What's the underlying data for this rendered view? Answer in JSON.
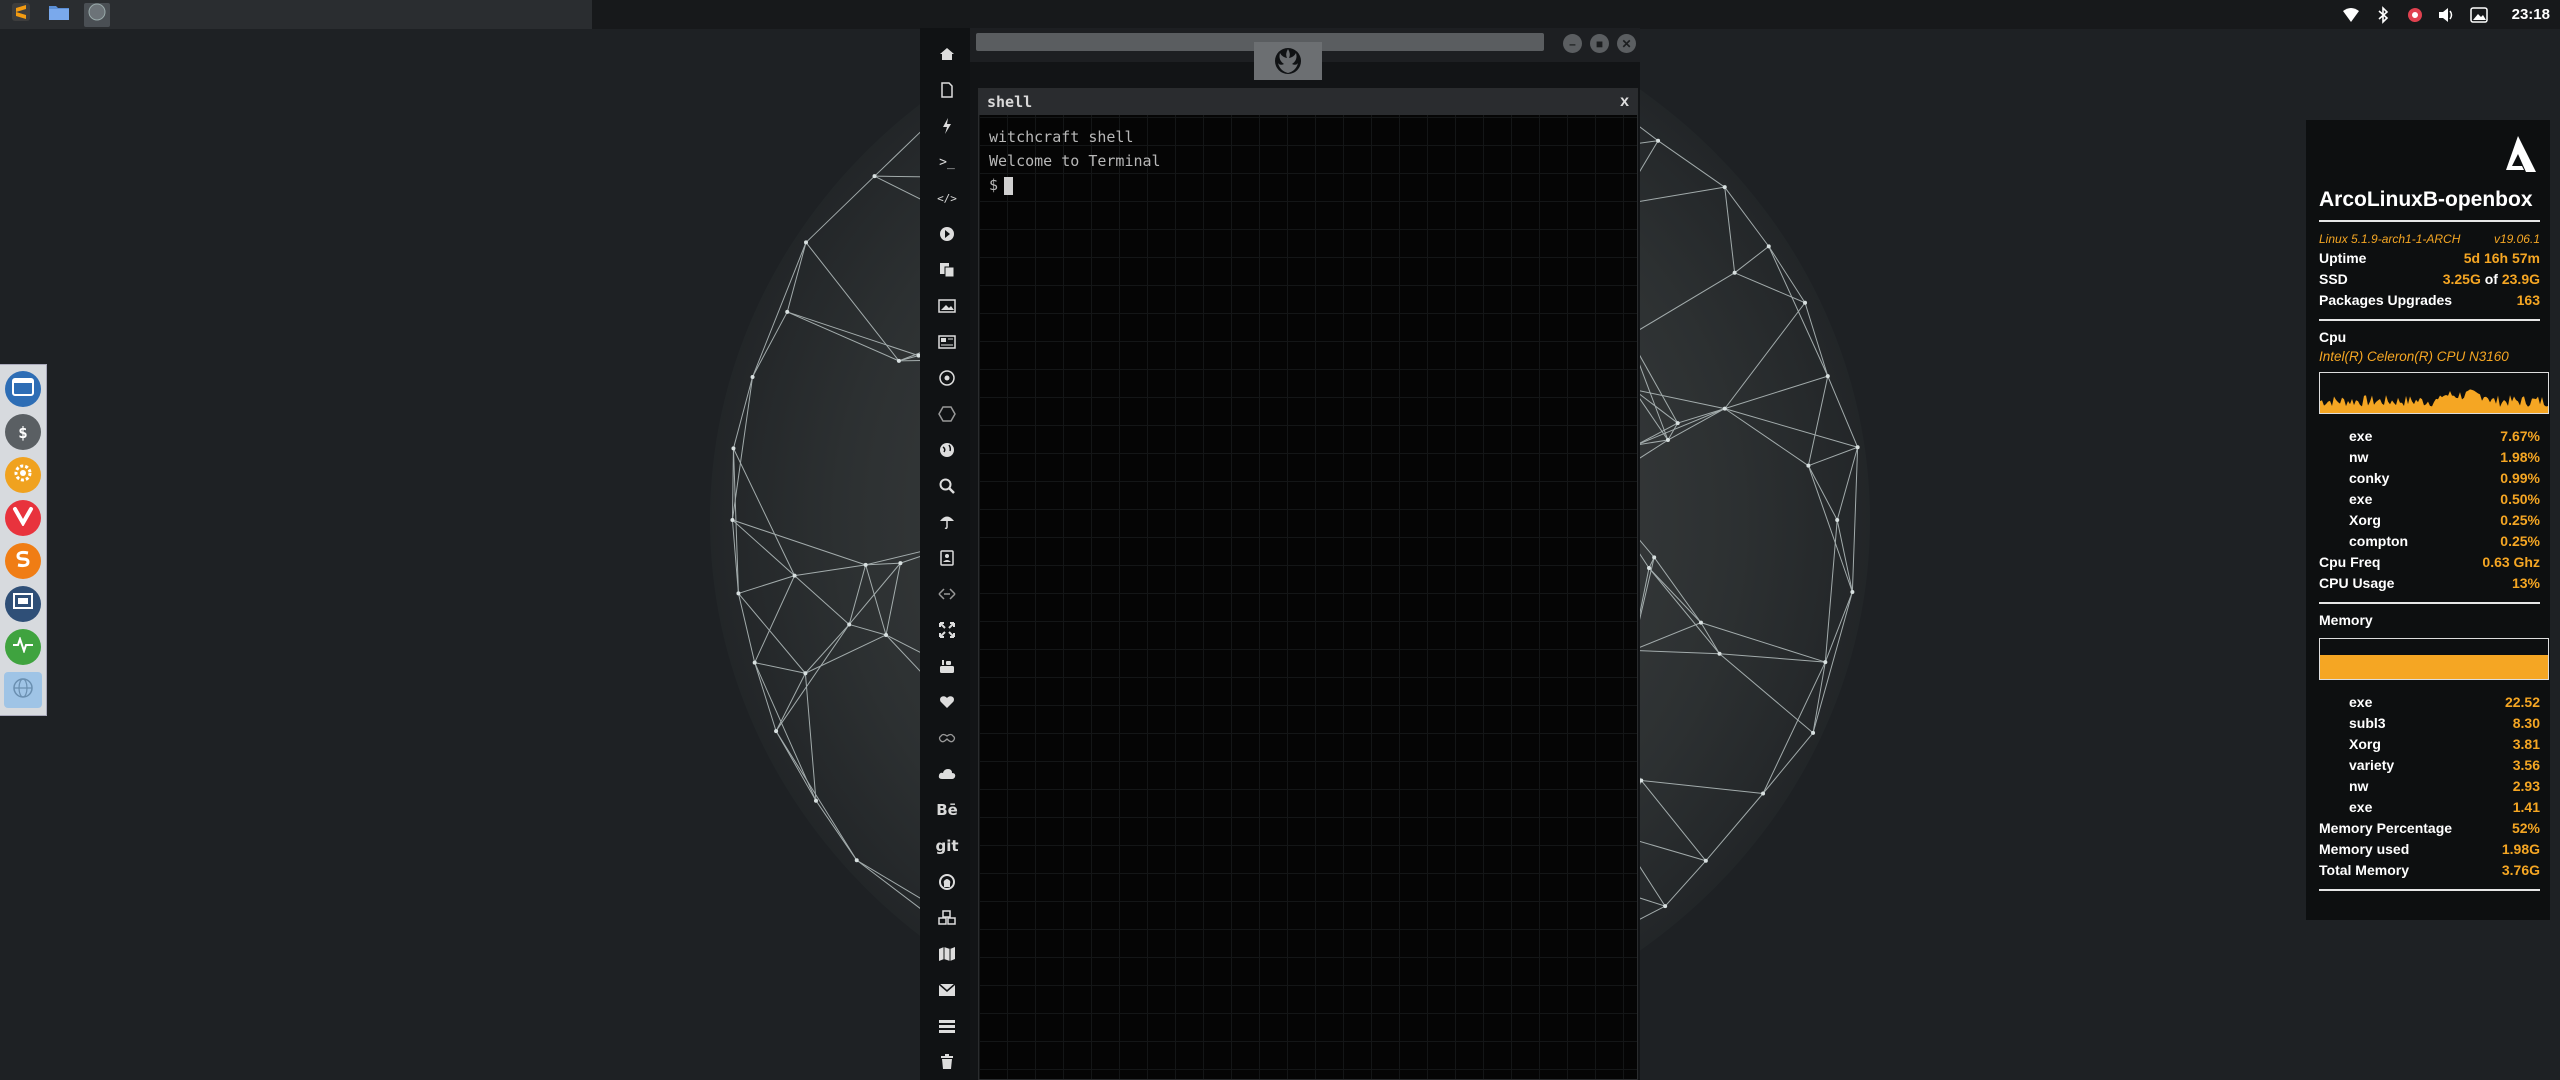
{
  "top_panel": {
    "apps": [
      {
        "name": "sublime-icon"
      },
      {
        "name": "files-icon"
      },
      {
        "name": "app-window-icon"
      }
    ],
    "clock": "23:18"
  },
  "terminal": {
    "title": "shell",
    "close": "x",
    "lines": [
      "witchcraft shell",
      "Welcome to Terminal"
    ],
    "prompt": "$"
  },
  "outer_window": {
    "controls": [
      "–",
      "■",
      "✕"
    ]
  },
  "icon_bar": {
    "labels": {
      "terminal": ">_",
      "code": "</>",
      "behance": "Bē",
      "git": "git"
    }
  },
  "conky": {
    "hostname": "ArcoLinuxB-openbox",
    "kernel": "Linux 5.1.9-arch1-1-ARCH",
    "version": "v19.06.1",
    "uptime_label": "Uptime",
    "uptime": "5d 16h 57m",
    "ssd_label": "SSD",
    "ssd_used": "3.25G",
    "ssd_of": "of",
    "ssd_total": "23.9G",
    "pkg_label": "Packages Upgrades",
    "pkg_value": "163",
    "cpu_section": "Cpu",
    "cpu_model": "Intel(R) Celeron(R) CPU  N3160",
    "cpu_procs": [
      {
        "name": "exe",
        "value": "7.67%"
      },
      {
        "name": "nw",
        "value": "1.98%"
      },
      {
        "name": "conky",
        "value": "0.99%"
      },
      {
        "name": "exe",
        "value": "0.50%"
      },
      {
        "name": "Xorg",
        "value": "0.25%"
      },
      {
        "name": "compton",
        "value": "0.25%"
      }
    ],
    "cpu_freq_label": "Cpu Freq",
    "cpu_freq": "0.63 Ghz",
    "cpu_usage_label": "CPU Usage",
    "cpu_usage": "13%",
    "mem_section": "Memory",
    "mem_procs": [
      {
        "name": "exe",
        "value": "22.52"
      },
      {
        "name": "subl3",
        "value": "8.30"
      },
      {
        "name": "Xorg",
        "value": "3.81"
      },
      {
        "name": "variety",
        "value": "3.56"
      },
      {
        "name": "nw",
        "value": "2.93"
      },
      {
        "name": "exe",
        "value": "1.41"
      }
    ],
    "mem_pct_label": "Memory Percentage",
    "mem_pct": "52%",
    "mem_used_label": "Memory used",
    "mem_used": "1.98G",
    "mem_total_label": "Total Memory",
    "mem_total": "3.76G"
  },
  "colors": {
    "accent": "#f5a623",
    "background": "#1e2124",
    "terminal_bg": "#050505"
  }
}
